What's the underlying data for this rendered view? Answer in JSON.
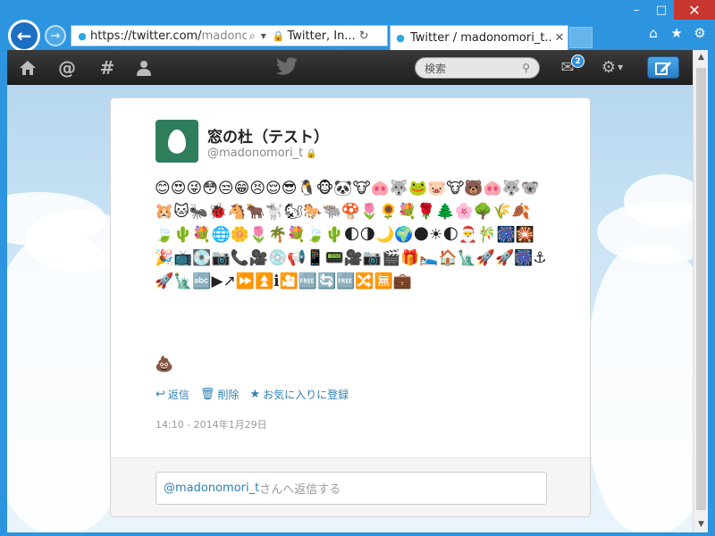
{
  "browser": {
    "url_visible": "https://twitter.com/",
    "url_dim": "madonom",
    "site_label": "Twitter, In...",
    "tab_title": "Twitter / madonomori_t...",
    "icons": [
      "home-icon",
      "star-icon",
      "gear-icon"
    ]
  },
  "window_controls": {
    "minimize": "–",
    "maximize": "□",
    "close": "✕"
  },
  "topbar": {
    "search_placeholder": "検索",
    "dm_count": "2"
  },
  "tweet": {
    "display_name": "窓の杜（テスト）",
    "screen_name": "@madonomori_t",
    "text": "😊😍😜😳😒😁😣😌😎🐧🐵🐼🐮🐽🐺🐸🐷🐮🐻🐽🐺🐨🐹🐱🐜🐞🐴🐂🐩🐿🐎🐃🍄🌷🌻💐🌹🌲🌸🌳🌾🍂🍃🌵💐🌐🌼🌷🌴💐🍃🌵🌓🌗🌙🌍🌑☀🌓🎅🎋🎆🎇🎉📺💽📷📞🎥💿📢📱📟🎥📷🎬🎁🛌🏠🗽🚀🚀🎆⚓🚀🗽🔤▶↗⏩⏫ℹ🎦🆓🔄🆓🔀🈚💼",
    "poop": "💩",
    "actions": [
      {
        "icon": "reply-icon",
        "label": "返信"
      },
      {
        "icon": "trash-icon",
        "label": "削除"
      },
      {
        "icon": "star-icon",
        "label": "お気に入りに登録"
      }
    ],
    "timestamp": "14:10 - 2014年1月29日"
  },
  "reply": {
    "mention": "@madonomori_t",
    "suffix": "さんへ返信する"
  }
}
